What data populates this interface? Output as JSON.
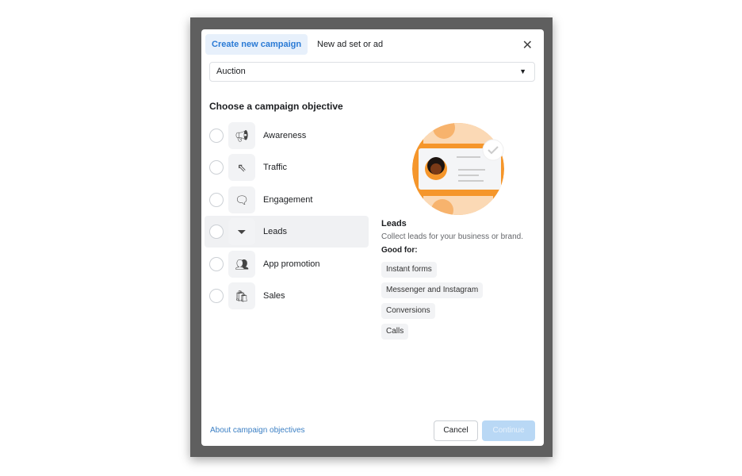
{
  "tabs": [
    {
      "label": "Create new campaign"
    },
    {
      "label": "New ad set or ad"
    }
  ],
  "buying_type": {
    "value": "Auction"
  },
  "heading": "Choose a campaign objective",
  "objectives": [
    {
      "label": "Awareness",
      "icon": "megaphone-icon"
    },
    {
      "label": "Traffic",
      "icon": "cursor-icon"
    },
    {
      "label": "Engagement",
      "icon": "chat-bubbles-icon"
    },
    {
      "label": "Leads",
      "icon": "funnel-icon",
      "selected_highlight": true
    },
    {
      "label": "App promotion",
      "icon": "people-icon"
    },
    {
      "label": "Sales",
      "icon": "shopping-bag-icon"
    }
  ],
  "preview": {
    "title": "Leads",
    "description": "Collect leads for your business or brand.",
    "good_for_label": "Good for:",
    "good_for": [
      "Instant forms",
      "Messenger and Instagram",
      "Conversions",
      "Calls"
    ],
    "accent_color": "#f5962b"
  },
  "footer": {
    "about_link": "About campaign objectives",
    "cancel": "Cancel",
    "continue": "Continue"
  }
}
